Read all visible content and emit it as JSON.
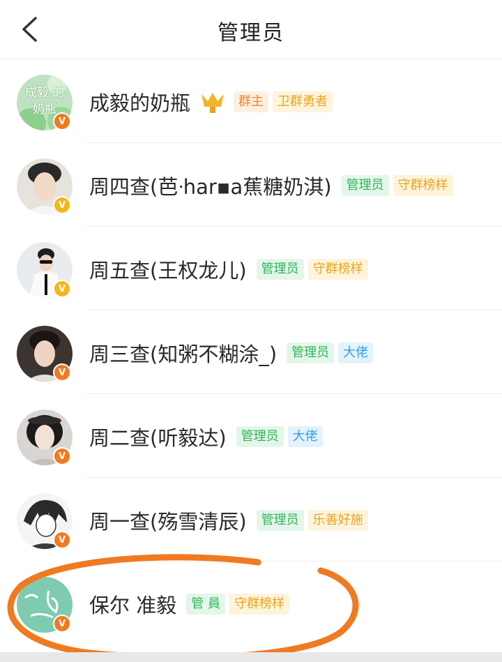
{
  "header": {
    "title": "管理员",
    "back_icon": "chevron-left-icon"
  },
  "members": [
    {
      "name": "成毅的奶瓶",
      "avatar_text": "成毅 的奶瓶",
      "badge": "orange",
      "crown": true,
      "tags": [
        {
          "label": "群主",
          "style": "owner"
        },
        {
          "label": "卫群勇者",
          "style": "gold"
        }
      ]
    },
    {
      "name": "周四查(芭ᐧhar▪a蕉糖奶淇)",
      "badge": "yellow",
      "crown": false,
      "tags": [
        {
          "label": "管理员",
          "style": "admin"
        },
        {
          "label": "守群榜样",
          "style": "gold"
        }
      ]
    },
    {
      "name": "周五查(王权龙儿)",
      "badge": "yellow",
      "crown": false,
      "tags": [
        {
          "label": "管理员",
          "style": "admin"
        },
        {
          "label": "守群榜样",
          "style": "gold"
        }
      ]
    },
    {
      "name": "周三查(知粥不糊涂_)",
      "badge": "orange",
      "crown": false,
      "tags": [
        {
          "label": "管理员",
          "style": "admin"
        },
        {
          "label": "大佬",
          "style": "blue"
        }
      ]
    },
    {
      "name": "周二查(听毅达)",
      "badge": "orange",
      "crown": false,
      "tags": [
        {
          "label": "管理员",
          "style": "admin"
        },
        {
          "label": "大佬",
          "style": "blue"
        }
      ]
    },
    {
      "name": "周一查(殇雪清辰)",
      "badge": "orange",
      "crown": false,
      "tags": [
        {
          "label": "管理员",
          "style": "admin"
        },
        {
          "label": "乐善好施",
          "style": "gold"
        }
      ]
    },
    {
      "name": "保尔 准毅",
      "badge": "orange",
      "crown": false,
      "tags": [
        {
          "label": "管 員",
          "style": "admin"
        },
        {
          "label": "守群榜样",
          "style": "gold"
        }
      ]
    }
  ],
  "badge_letter": "V",
  "colors": {
    "orange_badge": "#f07a21",
    "yellow_badge": "#f3b71a",
    "annotation": "#f07a21"
  }
}
